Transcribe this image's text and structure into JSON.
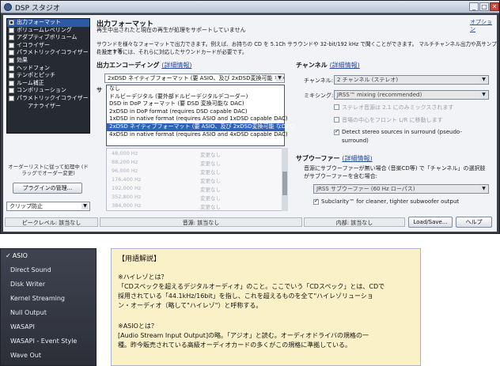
{
  "window": {
    "title": "DSP スタジオ",
    "min_label": "_",
    "max_label": "□",
    "close_label": "✕"
  },
  "sidebar": {
    "items": [
      {
        "label": "出力フォーマット",
        "checked": true,
        "selected": true
      },
      {
        "label": "ボリュームレベリング",
        "checked": false
      },
      {
        "label": "アダプティブボリューム",
        "checked": false
      },
      {
        "label": "イコライザー",
        "checked": false
      },
      {
        "label": "パラメトリックイコライザー",
        "checked": false
      },
      {
        "label": "効果",
        "checked": false
      },
      {
        "label": "ヘッドフォン",
        "checked": false
      },
      {
        "label": "テンポとピッチ",
        "checked": false
      },
      {
        "label": "ルーム補正",
        "checked": false
      },
      {
        "label": "コンボリューション",
        "checked": false
      },
      {
        "label": "パラメトリックイコライザー 2",
        "checked": false
      },
      {
        "label": "アナライザー",
        "indent": true
      }
    ],
    "note": "オーダーリストに従って処理中 (ドラッグでオーダー変更)",
    "plugin_button": "プラグインの管理...",
    "clip_select": "クリップ防止"
  },
  "main": {
    "title": "出力フォーマット",
    "subtitle": "再生中出されたと現在の再生が処理をサポートしていません",
    "options_link": "オプション",
    "description": [
      "サウンドを様々なフォーマットで出力できます。例えば、お持ちの CD を 5.1Ch サラウンドや 32-bit/192 kHz で聞くことができます。 マルチチャンネル出力や高サンプルレート等",
      "に設定するには、それらに対応したサウンドカードが必要です。"
    ],
    "encoding_label": "出力エンコーディング",
    "encoding_link": "(詳細情報)",
    "encoding_value": "2xDSD ネイティブフォーマット (要 ASIO、及び 2xDSD変換可能 なD...",
    "dropdown_options": [
      "なし",
      "ドルビーデジタル (要外部ドルビーデジタルデコーダー)",
      "DSD in DoP フォーマット (要 DSD 変換可能な DAC)",
      "2xDSD in DoP format (requires DSD capable DAC)",
      "1xDSD in native format (requires ASIO and 1xDSD capable DAC)",
      "2xDSD ネイティブフォーマット (要 ASIO、及び 2xDSD変換可能 なDAC)",
      "4xDSD in native format (requires ASIO and 4xDSD capable DAC)"
    ],
    "sample_rate_label": "サ",
    "freq_rows": [
      {
        "freq": "48,000 Hz",
        "state": "変更なし"
      },
      {
        "freq": "88,200 Hz",
        "state": "変更なし"
      },
      {
        "freq": "96,000 Hz",
        "state": "変更なし"
      },
      {
        "freq": "176,400 Hz",
        "state": "変更なし"
      },
      {
        "freq": "192,000 Hz",
        "state": "変更なし"
      },
      {
        "freq": "352,800 Hz",
        "state": "変更なし"
      },
      {
        "freq": "384,000 Hz",
        "state": "変更なし"
      }
    ]
  },
  "channel": {
    "heading": "チャンネル",
    "link": "(詳細情報)",
    "channel_label": "チャンネル:",
    "channel_value": "2 チャンネル (ステレオ)",
    "mixing_label": "ミキシング:",
    "mixing_value": "JRSS™ mixing (recommended)",
    "checks": [
      {
        "label": "ステレオ音源は 2.1 にのみミックスされます",
        "checked": false,
        "dim": true
      },
      {
        "label": "音場の中心をフロント L/R に移動します",
        "checked": false,
        "dim": true
      },
      {
        "label": "Detect stereo sources in surround (pseudo-",
        "checked": true,
        "dim": false
      }
    ],
    "surround_cont": "surround)"
  },
  "subwoofer": {
    "heading": "サブウーファー",
    "link": "(詳細情報)",
    "desc": [
      "音源にサブウーファーが無い場合 (音楽CD等) で「チャンネル」の選択肢",
      "がサブウーファーを含む場合:"
    ],
    "value": "JRSS サブウーファー (60 Hz ローパス)",
    "check_label": "Subclarity™ for cleaner, tighter subwoofer output",
    "checked": true
  },
  "statusbar": {
    "peak": "ピークレベル: 該当なし",
    "audio": "音源: 該当なし",
    "internal": "内部: 該当なし",
    "load_save": "Load/Save...",
    "help": "ヘルプ"
  },
  "asio_menu": {
    "items": [
      {
        "label": "ASIO",
        "checked": true
      },
      {
        "label": "Direct Sound",
        "checked": false
      },
      {
        "label": "Disk Writer",
        "checked": false
      },
      {
        "label": "Kernel Streaming",
        "checked": false
      },
      {
        "label": "Null Output",
        "checked": false
      },
      {
        "label": "WASAPI",
        "checked": false
      },
      {
        "label": "WASAPI - Event Style",
        "checked": false
      },
      {
        "label": "Wave Out",
        "checked": false
      }
    ],
    "check_mark": "✓"
  },
  "glossary": {
    "title": "【用語解説】",
    "hires_heading": "※ハイレゾとは？",
    "hires_lines": [
      "「CDスペックを超えるデジタルオーディオ」のこと。ここでいう「CDスペック」とは、CDで",
      "採用されている「44.1kHz/16bit」を指し、これを超えるものを全て\"ハイレゾリューショ",
      "ン・オーディオ（略して\"ハイレゾ\"）と呼称する。"
    ],
    "asio_heading": "※ASIOとは？",
    "asio_lines": [
      "[Audio Stream Input Output]の略。「アジオ」と読む。オーディオドライバの規格の一",
      "種。昨今販売されている高級オーディオカードの多くがこの規格に準拠している。"
    ]
  }
}
